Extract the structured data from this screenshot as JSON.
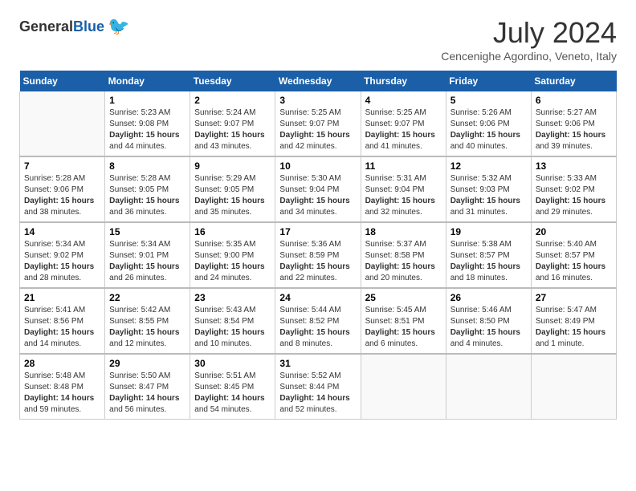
{
  "header": {
    "logo": {
      "general": "General",
      "blue": "Blue"
    },
    "title": "July 2024",
    "location": "Cencenighe Agordino, Veneto, Italy"
  },
  "calendar": {
    "days_of_week": [
      "Sunday",
      "Monday",
      "Tuesday",
      "Wednesday",
      "Thursday",
      "Friday",
      "Saturday"
    ],
    "weeks": [
      [
        {
          "day": "",
          "info": ""
        },
        {
          "day": "1",
          "info": "Sunrise: 5:23 AM\nSunset: 9:08 PM\nDaylight: 15 hours\nand 44 minutes."
        },
        {
          "day": "2",
          "info": "Sunrise: 5:24 AM\nSunset: 9:07 PM\nDaylight: 15 hours\nand 43 minutes."
        },
        {
          "day": "3",
          "info": "Sunrise: 5:25 AM\nSunset: 9:07 PM\nDaylight: 15 hours\nand 42 minutes."
        },
        {
          "day": "4",
          "info": "Sunrise: 5:25 AM\nSunset: 9:07 PM\nDaylight: 15 hours\nand 41 minutes."
        },
        {
          "day": "5",
          "info": "Sunrise: 5:26 AM\nSunset: 9:06 PM\nDaylight: 15 hours\nand 40 minutes."
        },
        {
          "day": "6",
          "info": "Sunrise: 5:27 AM\nSunset: 9:06 PM\nDaylight: 15 hours\nand 39 minutes."
        }
      ],
      [
        {
          "day": "7",
          "info": "Sunrise: 5:28 AM\nSunset: 9:06 PM\nDaylight: 15 hours\nand 38 minutes."
        },
        {
          "day": "8",
          "info": "Sunrise: 5:28 AM\nSunset: 9:05 PM\nDaylight: 15 hours\nand 36 minutes."
        },
        {
          "day": "9",
          "info": "Sunrise: 5:29 AM\nSunset: 9:05 PM\nDaylight: 15 hours\nand 35 minutes."
        },
        {
          "day": "10",
          "info": "Sunrise: 5:30 AM\nSunset: 9:04 PM\nDaylight: 15 hours\nand 34 minutes."
        },
        {
          "day": "11",
          "info": "Sunrise: 5:31 AM\nSunset: 9:04 PM\nDaylight: 15 hours\nand 32 minutes."
        },
        {
          "day": "12",
          "info": "Sunrise: 5:32 AM\nSunset: 9:03 PM\nDaylight: 15 hours\nand 31 minutes."
        },
        {
          "day": "13",
          "info": "Sunrise: 5:33 AM\nSunset: 9:02 PM\nDaylight: 15 hours\nand 29 minutes."
        }
      ],
      [
        {
          "day": "14",
          "info": "Sunrise: 5:34 AM\nSunset: 9:02 PM\nDaylight: 15 hours\nand 28 minutes."
        },
        {
          "day": "15",
          "info": "Sunrise: 5:34 AM\nSunset: 9:01 PM\nDaylight: 15 hours\nand 26 minutes."
        },
        {
          "day": "16",
          "info": "Sunrise: 5:35 AM\nSunset: 9:00 PM\nDaylight: 15 hours\nand 24 minutes."
        },
        {
          "day": "17",
          "info": "Sunrise: 5:36 AM\nSunset: 8:59 PM\nDaylight: 15 hours\nand 22 minutes."
        },
        {
          "day": "18",
          "info": "Sunrise: 5:37 AM\nSunset: 8:58 PM\nDaylight: 15 hours\nand 20 minutes."
        },
        {
          "day": "19",
          "info": "Sunrise: 5:38 AM\nSunset: 8:57 PM\nDaylight: 15 hours\nand 18 minutes."
        },
        {
          "day": "20",
          "info": "Sunrise: 5:40 AM\nSunset: 8:57 PM\nDaylight: 15 hours\nand 16 minutes."
        }
      ],
      [
        {
          "day": "21",
          "info": "Sunrise: 5:41 AM\nSunset: 8:56 PM\nDaylight: 15 hours\nand 14 minutes."
        },
        {
          "day": "22",
          "info": "Sunrise: 5:42 AM\nSunset: 8:55 PM\nDaylight: 15 hours\nand 12 minutes."
        },
        {
          "day": "23",
          "info": "Sunrise: 5:43 AM\nSunset: 8:54 PM\nDaylight: 15 hours\nand 10 minutes."
        },
        {
          "day": "24",
          "info": "Sunrise: 5:44 AM\nSunset: 8:52 PM\nDaylight: 15 hours\nand 8 minutes."
        },
        {
          "day": "25",
          "info": "Sunrise: 5:45 AM\nSunset: 8:51 PM\nDaylight: 15 hours\nand 6 minutes."
        },
        {
          "day": "26",
          "info": "Sunrise: 5:46 AM\nSunset: 8:50 PM\nDaylight: 15 hours\nand 4 minutes."
        },
        {
          "day": "27",
          "info": "Sunrise: 5:47 AM\nSunset: 8:49 PM\nDaylight: 15 hours\nand 1 minute."
        }
      ],
      [
        {
          "day": "28",
          "info": "Sunrise: 5:48 AM\nSunset: 8:48 PM\nDaylight: 14 hours\nand 59 minutes."
        },
        {
          "day": "29",
          "info": "Sunrise: 5:50 AM\nSunset: 8:47 PM\nDaylight: 14 hours\nand 56 minutes."
        },
        {
          "day": "30",
          "info": "Sunrise: 5:51 AM\nSunset: 8:45 PM\nDaylight: 14 hours\nand 54 minutes."
        },
        {
          "day": "31",
          "info": "Sunrise: 5:52 AM\nSunset: 8:44 PM\nDaylight: 14 hours\nand 52 minutes."
        },
        {
          "day": "",
          "info": ""
        },
        {
          "day": "",
          "info": ""
        },
        {
          "day": "",
          "info": ""
        }
      ]
    ]
  }
}
